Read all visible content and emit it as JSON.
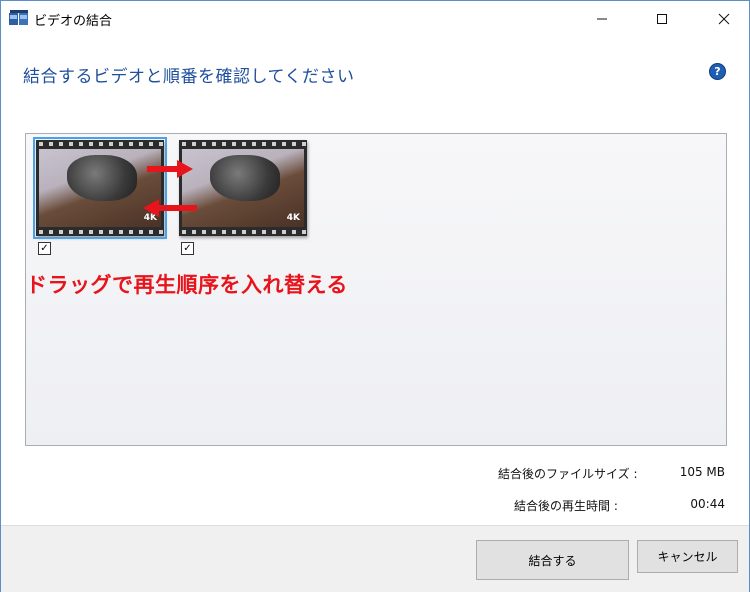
{
  "window": {
    "title": "ビデオの結合",
    "controls": {
      "minimize": "—",
      "maximize": "☐",
      "close": "✕"
    }
  },
  "heading": "結合するビデオと順番を確認してください",
  "help": "?",
  "clips": [
    {
      "badge": "4K",
      "checked": "✓",
      "selected": true
    },
    {
      "badge": "4K",
      "checked": "✓",
      "selected": false
    }
  ],
  "annotation": "ドラッグで再生順序を入れ替える",
  "info": {
    "size_label": "結合後のファイルサイズ :",
    "size_value": "105 MB",
    "time_label": "結合後の再生時間 :",
    "time_value": "00:44"
  },
  "buttons": {
    "ok": "結合する",
    "cancel": "キャンセル"
  },
  "colors": {
    "heading": "#1e4f9c",
    "annotation": "#e8141b",
    "selection": "#4aa3e8"
  }
}
